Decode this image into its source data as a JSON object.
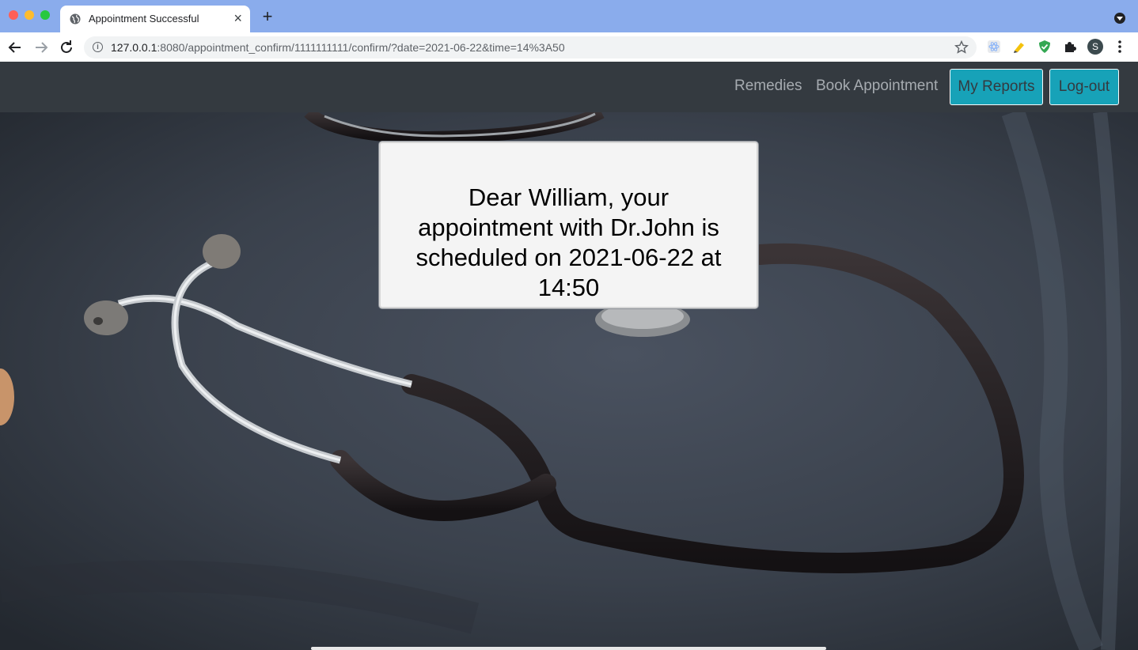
{
  "browser": {
    "tab_title": "Appointment Successful",
    "tab_close": "×",
    "new_tab": "+",
    "url_host": "127.0.0.1",
    "url_rest": ":8080/appointment_confirm/1111111111/confirm/?date=2021-06-22&time=14%3A50",
    "profile_initial": "S",
    "icons": {
      "back": "arrow-left-icon",
      "forward": "arrow-right-icon",
      "reload": "reload-icon",
      "info": "info-icon",
      "bookmark": "star-icon",
      "menu": "kebab-icon"
    }
  },
  "navbar": {
    "remedies": "Remedies",
    "book_appointment": "Book Appointment",
    "my_reports": "My Reports",
    "logout": "Log-out",
    "accent_color": "#17a2b8",
    "bg_color": "#343a40"
  },
  "confirmation": {
    "message": "Dear William, your appointment with Dr.John is scheduled on 2021-06-22 at 14:50"
  }
}
